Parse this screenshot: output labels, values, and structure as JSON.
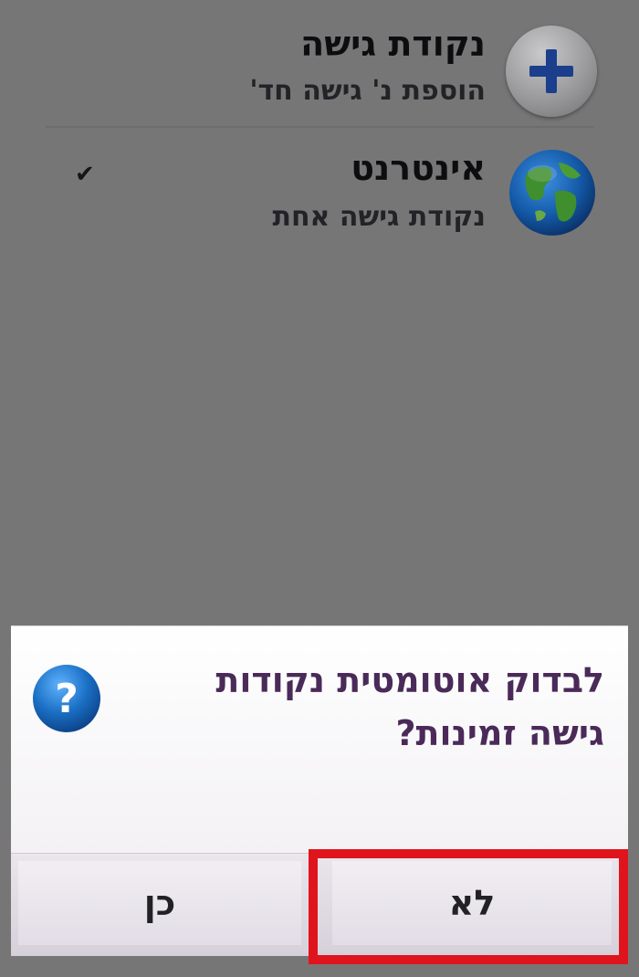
{
  "list": {
    "items": [
      {
        "title": "נקודת גישה",
        "subtitle": "הוספת נ' גישה חד'",
        "icon": "plus-icon"
      },
      {
        "title": "אינטרנט",
        "subtitle": "נקודת גישה אחת",
        "icon": "globe-icon",
        "checked": true
      }
    ]
  },
  "dialog": {
    "message_line1": "לבדוק אוטומטית נקודות",
    "message_line2": "גישה זמינות?",
    "icon": "question-icon",
    "yes_label": "כן",
    "no_label": "לא"
  },
  "colors": {
    "background": "#777677",
    "dialog_text": "#4a2a58",
    "highlight": "#e0141c",
    "question_icon": "#1a6fc4"
  }
}
